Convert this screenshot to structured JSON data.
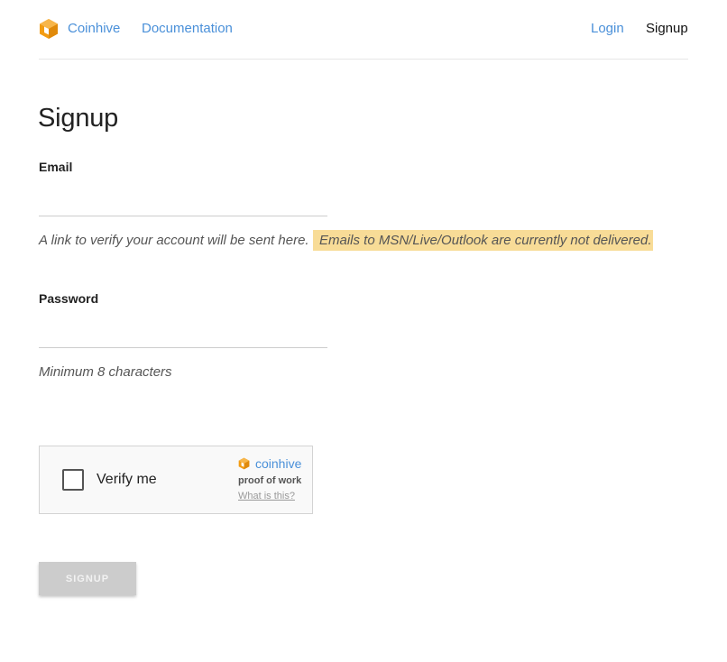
{
  "header": {
    "brand": {
      "label": "Coinhive",
      "icon": "coinhive-cube-icon"
    },
    "nav_links": {
      "documentation": "Documentation",
      "login": "Login",
      "signup": "Signup"
    }
  },
  "colors": {
    "link": "#4a90d9",
    "brand_orange": "#f39c12",
    "warning_bg": "#f8dc97",
    "button_disabled_bg": "#cccccc"
  },
  "form": {
    "title": "Signup",
    "email": {
      "label": "Email",
      "value": "",
      "placeholder": "",
      "hint": "A link to verify your account will be sent here.",
      "warning": "Emails to MSN/Live/Outlook are currently not delivered."
    },
    "password": {
      "label": "Password",
      "value": "",
      "placeholder": "",
      "hint": "Minimum 8 characters"
    },
    "captcha": {
      "checkbox_label": "Verify me",
      "checked": false,
      "brand": "coinhive",
      "brand_icon": "coinhive-cube-icon",
      "subtitle": "proof of work",
      "help_link": "What is this?"
    },
    "submit_label": "SIGNUP",
    "submit_enabled": false
  }
}
